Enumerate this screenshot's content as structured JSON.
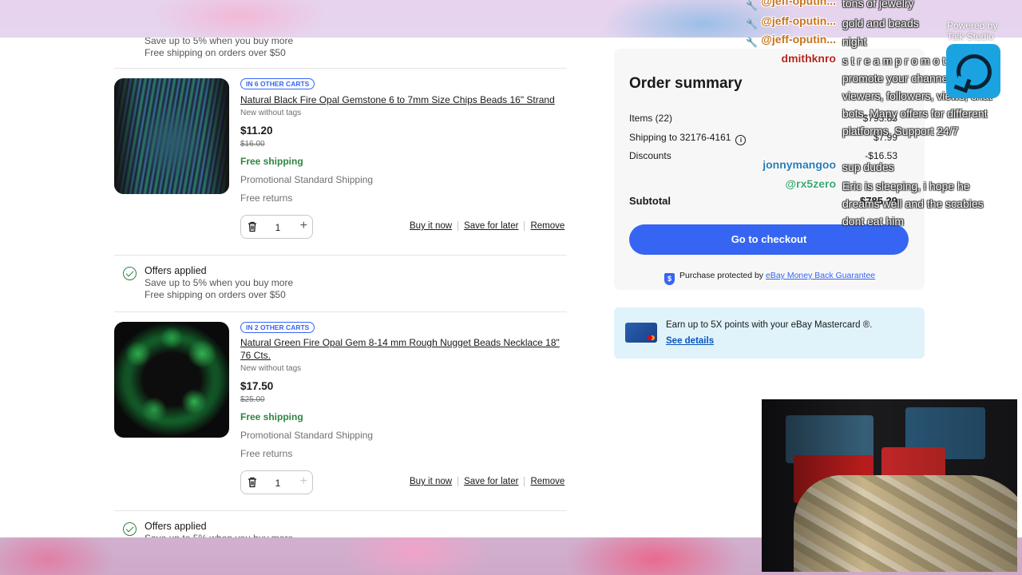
{
  "offers_top": {
    "line1": "Save up to 5% when you buy more",
    "line2": "Free shipping on orders over $50"
  },
  "items": [
    {
      "badge": "IN 6 OTHER CARTS",
      "title": "Natural Black Fire Opal Gemstone 6 to 7mm Size Chips Beads 16\" Strand",
      "condition": "New without tags",
      "price": "$11.20",
      "was_price": "$16.00",
      "shipping": "Free shipping",
      "shipping_method": "Promotional Standard Shipping",
      "returns": "Free returns",
      "qty": "1"
    },
    {
      "badge": "IN 2 OTHER CARTS",
      "title": "Natural Green Fire Opal Gem 8-14 mm Rough Nugget Beads Necklace 18\" 76 Cts.",
      "condition": "New without tags",
      "price": "$17.50",
      "was_price": "$25.00",
      "shipping": "Free shipping",
      "shipping_method": "Promotional Standard Shipping",
      "returns": "Free returns",
      "qty": "1"
    }
  ],
  "item_actions": {
    "buy": "Buy it now",
    "save": "Save for later",
    "remove": "Remove"
  },
  "offers": {
    "title": "Offers applied",
    "line1": "Save up to 5% when you buy more",
    "line2": "Free shipping on orders over $50"
  },
  "summary": {
    "title": "Order summary",
    "items_label": "Items (22)",
    "items_value": "$793.83",
    "shipping_label": "Shipping to 32176-4161",
    "shipping_value": "$7.99",
    "discounts_label": "Discounts",
    "discounts_value": "-$16.53",
    "subtotal_label": "Subtotal",
    "subtotal_value": "$785.29",
    "checkout": "Go to checkout",
    "protect_text": "Purchase protected by",
    "protect_link": "eBay Money Back Guarantee"
  },
  "card_promo": {
    "text": "Earn up to 5X points with your eBay Mastercard ®.",
    "link": "See details"
  },
  "chat": [
    {
      "user": "@jeff-oputin...",
      "message": "tons of jewelry",
      "color": "#c9721c",
      "mod": true
    },
    {
      "user": "@jeff-oputin...",
      "message": "gold and beads",
      "color": "#c9721c",
      "mod": true
    },
    {
      "user": "@jeff-oputin...",
      "message": "night",
      "color": "#c9721c",
      "mod": true
    },
    {
      "user": "dmithknro",
      "message": "s t r e a m p r o m o t e promote your channel viewers, followers, views, chat bots. Many offers for different platforms. Support 24/7",
      "color": "#b3261e",
      "mod": false
    },
    {
      "user": "jonnymangoo",
      "message": "sup dudes",
      "color": "#2a7bb8",
      "mod": false
    },
    {
      "user": "@rx5zero",
      "message": "Eric is sleeping, i hope he dreams well and the scabies dont eat him",
      "color": "#3aa870",
      "mod": false
    }
  ],
  "overlay": {
    "powered_line1": "Powered by",
    "powered_line2": "Talk Studio"
  }
}
